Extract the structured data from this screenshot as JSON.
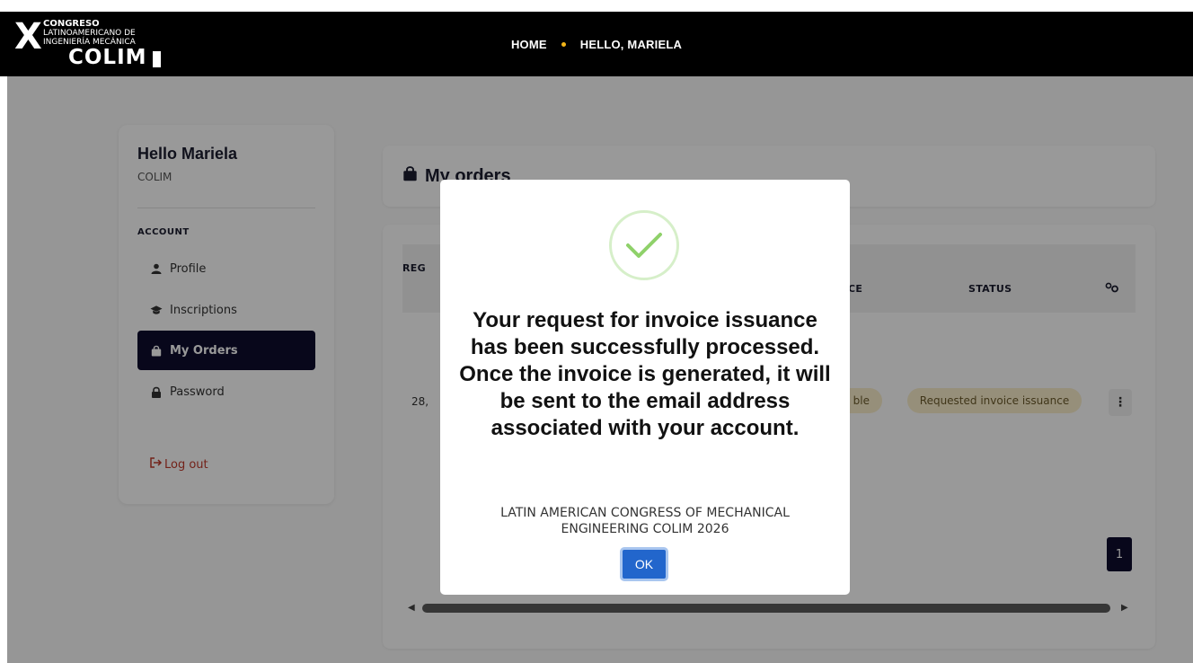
{
  "header": {
    "logo": {
      "line1": "CONGRESO",
      "line2": "LATINOAMERICANO DE",
      "line3": "INGENIERÍA MECÁNICA",
      "brand": "COLIM"
    },
    "nav": [
      {
        "label": "HOME"
      },
      {
        "label": "HELLO, MARIELA"
      }
    ],
    "accent_color": "#f2b418"
  },
  "sidebar": {
    "greeting": "Hello Mariela",
    "org": "COLIM",
    "section": "ACCOUNT",
    "items": [
      {
        "label": "Profile",
        "icon": "user-icon"
      },
      {
        "label": "Inscriptions",
        "icon": "graduation-cap-icon"
      },
      {
        "label": "My Orders",
        "icon": "shopping-bag-icon",
        "active": true
      },
      {
        "label": "Password",
        "icon": "lock-icon"
      }
    ],
    "logout": "Log out",
    "active_color": "#0e0d2e"
  },
  "main": {
    "title": "My orders",
    "table": {
      "headers": [
        "REG",
        "CE",
        "STATUS"
      ],
      "row": {
        "first_cell": "28,",
        "badge_partial": "ble",
        "status": "Requested invoice issuance"
      }
    },
    "pagination": {
      "current": "1"
    }
  },
  "modal": {
    "message": "Your request for invoice issuance has been successfully processed. Once the invoice is generated, it will be sent to the email address associated with your account.",
    "subtitle": "LATIN AMERICAN CONGRESS OF MECHANICAL ENGINEERING COLIM 2026",
    "ok_label": "OK",
    "success_color": "#8fd16a",
    "button_color": "#2266cc"
  }
}
